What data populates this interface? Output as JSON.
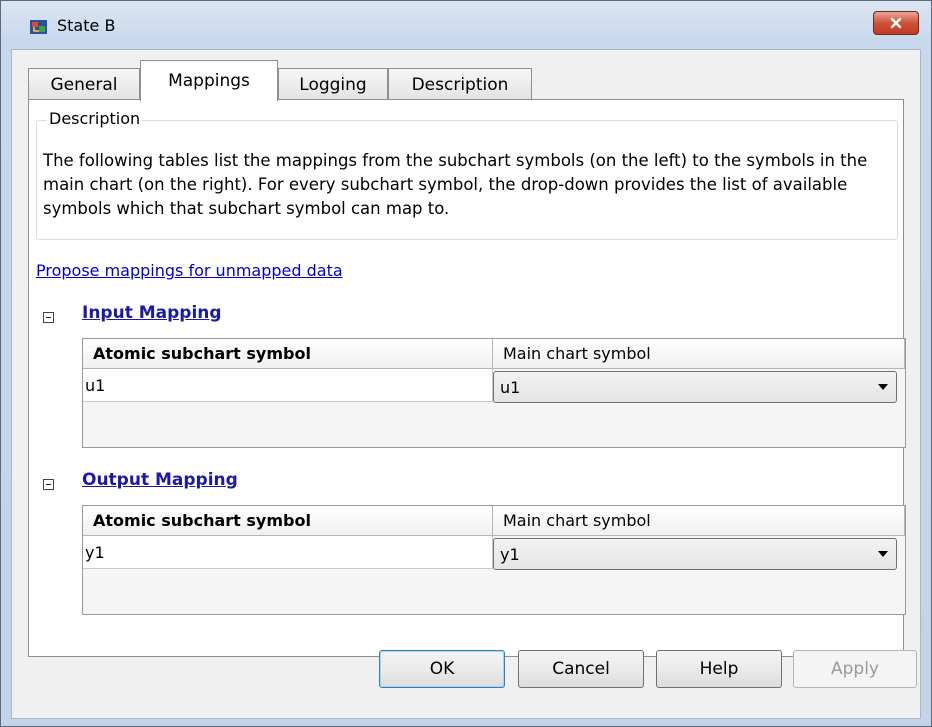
{
  "window": {
    "title": "State B"
  },
  "tabs": [
    {
      "label": "General"
    },
    {
      "label": "Mappings"
    },
    {
      "label": "Logging"
    },
    {
      "label": "Description"
    }
  ],
  "description": {
    "legend": "Description",
    "text": "The following tables list the mappings from the subchart symbols (on the left) to the symbols in the main chart (on the right). For every subchart symbol, the drop-down provides the list of available symbols which that subchart symbol can map to."
  },
  "propose_link": "Propose mappings for unmapped data",
  "input_mapping": {
    "title": "Input Mapping",
    "col1": "Atomic subchart symbol",
    "col2": "Main chart symbol",
    "rows": [
      {
        "symbol": "u1",
        "main": "u1"
      }
    ]
  },
  "output_mapping": {
    "title": "Output Mapping",
    "col1": "Atomic subchart symbol",
    "col2": "Main chart symbol",
    "rows": [
      {
        "symbol": "y1",
        "main": "y1"
      }
    ]
  },
  "buttons": {
    "ok": "OK",
    "cancel": "Cancel",
    "help": "Help",
    "apply": "Apply"
  },
  "icons": {
    "app": "stateflow-chart-icon",
    "close": "close-icon",
    "collapse": "collapse-minus-icon",
    "dropdown": "dropdown-arrow-icon"
  },
  "colors": {
    "link": "#0000cc",
    "section_link": "#1a1aa6",
    "close_button": "#c23b22"
  }
}
